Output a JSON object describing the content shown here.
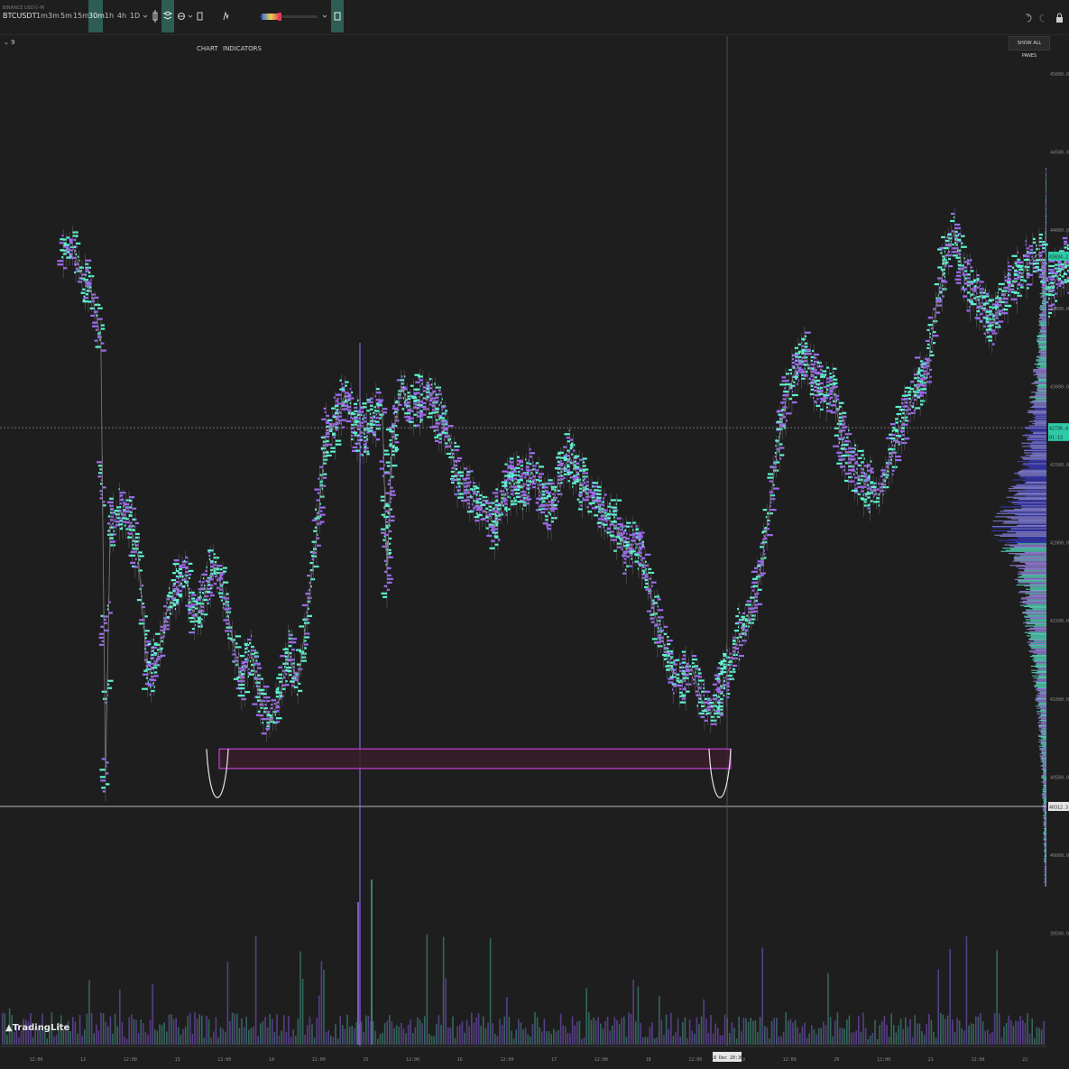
{
  "toolbar": {
    "exchange": "BINANCE USDⓈ-M",
    "symbol": "BTCUSDT",
    "timeframes": [
      "1m",
      "3m",
      "5m",
      "15m",
      "30m",
      "1h",
      "4h",
      "1D"
    ],
    "active_timeframe": "30m",
    "chart_button": "CHART",
    "indicators_button": "INDICATORS",
    "show_all_panes": "SHOW ALL PANES",
    "pane_label": "9"
  },
  "icons": [
    "chevron-down-icon",
    "candle-type-icon",
    "layers-icon",
    "chart-icon",
    "indicators-icon",
    "undo-icon",
    "redo-icon",
    "lock-icon",
    "settings-icon"
  ],
  "colors": {
    "background": "#1e1e1f",
    "bull": "#5ef2d1",
    "bear": "#9d6cf0",
    "zone_fill": "#3a1f2a",
    "zone_stroke": "#c43fd6",
    "accent": "#2e5d54",
    "last_price_bg": "#2fc9a6"
  },
  "chart_data": {
    "type": "line",
    "title": "",
    "xlabel": "",
    "ylabel": "",
    "ylim": [
      39450,
      45400
    ],
    "yticks": [
      "45000.00",
      "44500.00",
      "44000.00",
      "43500.00",
      "43000.00",
      "42500.00",
      "42000.00",
      "41500.00",
      "41000.00",
      "40500.00",
      "40000.00",
      "39500.00"
    ],
    "x_ticks": [
      "12:00",
      "12",
      "12:00",
      "13",
      "12:00",
      "14",
      "12:00",
      "15",
      "12:00",
      "16",
      "12:00",
      "17",
      "12:00",
      "18",
      "12:00",
      "19",
      "12:00",
      "20",
      "12:00",
      "21",
      "12:00",
      "22"
    ],
    "crosshair_x_label": "18 Dec 20:30",
    "price_labels": [
      {
        "text": "43834.2",
        "value": 43834
      },
      {
        "text": "42736.4",
        "value": 42736
      },
      {
        "text": "01:13",
        "value": 42680
      },
      {
        "text": "40312.3",
        "value": 40312
      }
    ],
    "dotted_line_value": 42736,
    "support_line_value": 40312,
    "zone": {
      "low": 40555,
      "high": 40680,
      "start_day": 13.25,
      "end_day": 18.6
    },
    "price_series": {
      "name": "BTCUSDT 30m",
      "x": [
        11.3,
        11.4,
        11.5,
        11.6,
        11.7,
        11.75,
        11.8,
        11.9,
        12.0,
        12.1,
        12.2,
        12.3,
        12.4,
        12.5,
        12.6,
        12.7,
        12.8,
        12.9,
        13.0,
        13.1,
        13.2,
        13.3,
        13.4,
        13.5,
        13.6,
        13.7,
        13.8,
        13.9,
        14.0,
        14.1,
        14.2,
        14.3,
        14.4,
        14.5,
        14.6,
        14.7,
        14.75,
        14.8,
        14.9,
        15.0,
        15.1,
        15.2,
        15.3,
        15.4,
        15.5,
        15.6,
        15.7,
        15.8,
        15.9,
        16.0,
        16.1,
        16.2,
        16.3,
        16.4,
        16.5,
        16.6,
        16.7,
        16.8,
        16.9,
        17.0,
        17.1,
        17.2,
        17.3,
        17.4,
        17.5,
        17.6,
        17.7,
        17.8,
        17.9,
        18.0,
        18.1,
        18.2,
        18.3,
        18.4,
        18.5,
        18.6,
        18.7,
        18.8,
        18.9,
        19.0,
        19.1,
        19.2,
        19.3,
        19.4,
        19.5,
        19.6,
        19.7,
        19.8,
        19.9,
        20.0,
        20.1,
        20.2,
        20.3,
        20.4,
        20.5,
        20.6,
        20.7,
        20.8,
        20.9,
        21.0,
        21.1,
        21.2,
        21.3,
        21.4,
        21.5,
        21.6,
        21.7,
        21.8,
        21.9,
        22.0,
        22.1,
        22.2
      ],
      "values": [
        43850,
        43900,
        43700,
        43600,
        43300,
        40500,
        42100,
        42200,
        42150,
        41900,
        41150,
        41250,
        41550,
        41700,
        41800,
        41500,
        41650,
        41850,
        41700,
        41400,
        41100,
        41300,
        41000,
        40850,
        41000,
        41300,
        41100,
        41550,
        42050,
        42700,
        42750,
        42950,
        42750,
        42700,
        42800,
        42850,
        41800,
        42600,
        43000,
        42850,
        42900,
        42950,
        42800,
        42700,
        42400,
        42350,
        42250,
        42200,
        42100,
        42300,
        42400,
        42350,
        42450,
        42300,
        42200,
        42450,
        42550,
        42400,
        42300,
        42250,
        42150,
        42100,
        41950,
        42000,
        41850,
        41550,
        41350,
        41150,
        41100,
        41200,
        41000,
        40900,
        41050,
        41200,
        41400,
        41500,
        41700,
        42100,
        42550,
        42900,
        43100,
        43200,
        43050,
        42950,
        43000,
        42650,
        42500,
        42400,
        42350,
        42300,
        42500,
        42700,
        42850,
        43000,
        43050,
        43500,
        43800,
        44000,
        43700,
        43600,
        43500,
        43400,
        43550,
        43650,
        43700,
        43800,
        43850,
        43600,
        43700,
        43800,
        43700,
        43600
      ]
    },
    "profile_levels": [
      39800,
      40050,
      40200,
      40350,
      40500,
      40700,
      40850,
      41000,
      41150,
      41300,
      41450,
      41600,
      41800,
      42000,
      42100,
      42200,
      42300,
      42400,
      42550,
      42700,
      42850,
      43000,
      43150,
      43300,
      43450,
      43600,
      43750,
      43900,
      44050,
      44200
    ]
  },
  "brand": {
    "watermark": "TradingLite"
  }
}
